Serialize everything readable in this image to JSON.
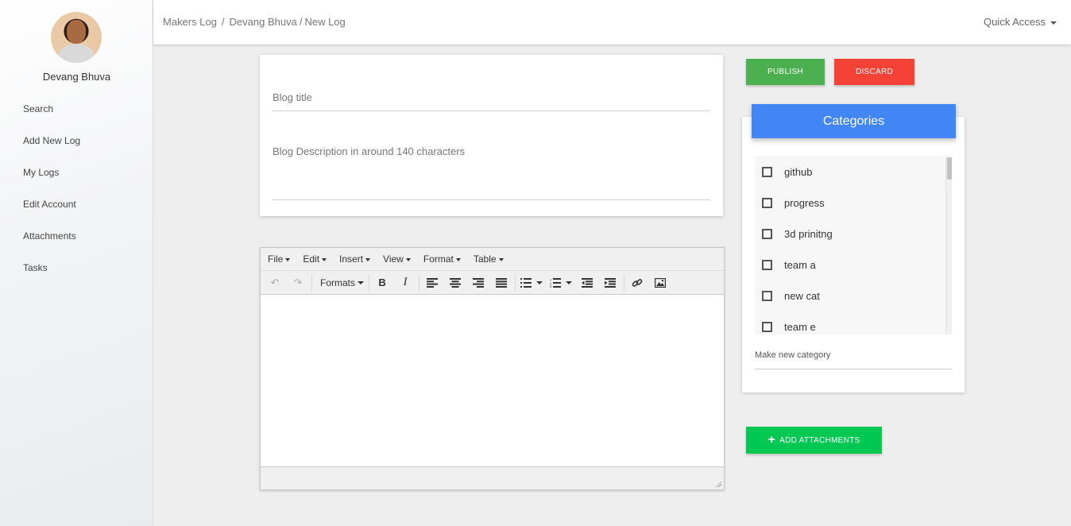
{
  "sidebar": {
    "user_name": "Devang Bhuva",
    "items": [
      {
        "label": "Search"
      },
      {
        "label": "Add New Log"
      },
      {
        "label": "My Logs"
      },
      {
        "label": "Edit Account"
      },
      {
        "label": "Attachments"
      },
      {
        "label": "Tasks"
      }
    ]
  },
  "topbar": {
    "breadcrumb": [
      "Makers Log",
      "Devang Bhuva",
      "New Log"
    ],
    "quick_access": "Quick Access"
  },
  "blog": {
    "title_placeholder": "Blog title",
    "description_placeholder": "Blog Description in around 140 characters"
  },
  "editor": {
    "menus": [
      "File",
      "Edit",
      "Insert",
      "View",
      "Format",
      "Table"
    ],
    "formats_label": "Formats"
  },
  "actions": {
    "publish": "PUBLISH",
    "discard": "DISCARD",
    "add_attachments": "ADD ATTACHMENTS"
  },
  "categories": {
    "header": "Categories",
    "items": [
      "github",
      "progress",
      "3d prinitng",
      "team a",
      "new cat",
      "team e"
    ],
    "new_placeholder": "Make new category"
  },
  "colors": {
    "publish": "#4caf50",
    "discard": "#f44336",
    "categories_header": "#4285f4",
    "attach": "#00c853"
  }
}
